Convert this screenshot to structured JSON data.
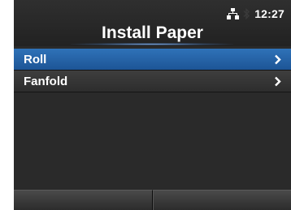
{
  "status": {
    "time": "12:27",
    "icons": [
      "network-icon",
      "bluetooth-icon"
    ]
  },
  "header": {
    "title": "Install Paper"
  },
  "menu": {
    "items": [
      {
        "label": "Roll",
        "selected": true
      },
      {
        "label": "Fanfold",
        "selected": false
      }
    ]
  },
  "colors": {
    "selected_row": "#2563a8",
    "background": "#2a2a2a",
    "text": "#ffffff"
  }
}
